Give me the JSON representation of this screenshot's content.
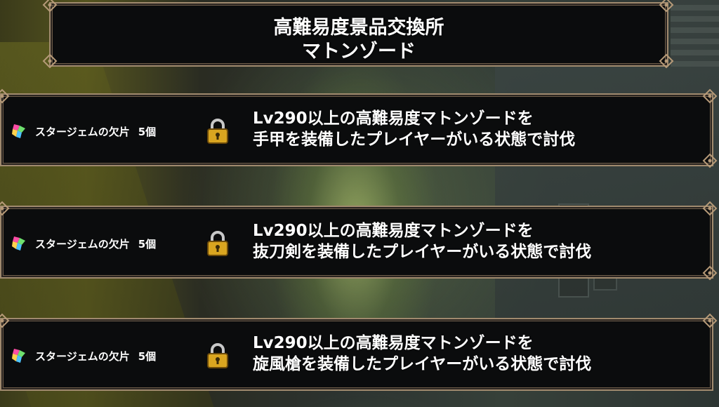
{
  "header": {
    "title_line1": "高難易度景品交換所",
    "title_line2": "マトンゾード"
  },
  "rewards": [
    {
      "icon": "star-gem-fragment-icon",
      "item_name": "スタージェムの欠片",
      "quantity": "5個",
      "locked": true,
      "condition_line1": "Lv290以上の高難易度マトンゾードを",
      "condition_line2": "手甲を装備したプレイヤーがいる状態で討伐"
    },
    {
      "icon": "star-gem-fragment-icon",
      "item_name": "スタージェムの欠片",
      "quantity": "5個",
      "locked": true,
      "condition_line1": "Lv290以上の高難易度マトンゾードを",
      "condition_line2": "抜刀剣を装備したプレイヤーがいる状態で討伐"
    },
    {
      "icon": "star-gem-fragment-icon",
      "item_name": "スタージェムの欠片",
      "quantity": "5個",
      "locked": true,
      "condition_line1": "Lv290以上の高難易度マトンゾードを",
      "condition_line2": "旋風槍を装備したプレイヤーがいる状態で討伐"
    }
  ]
}
